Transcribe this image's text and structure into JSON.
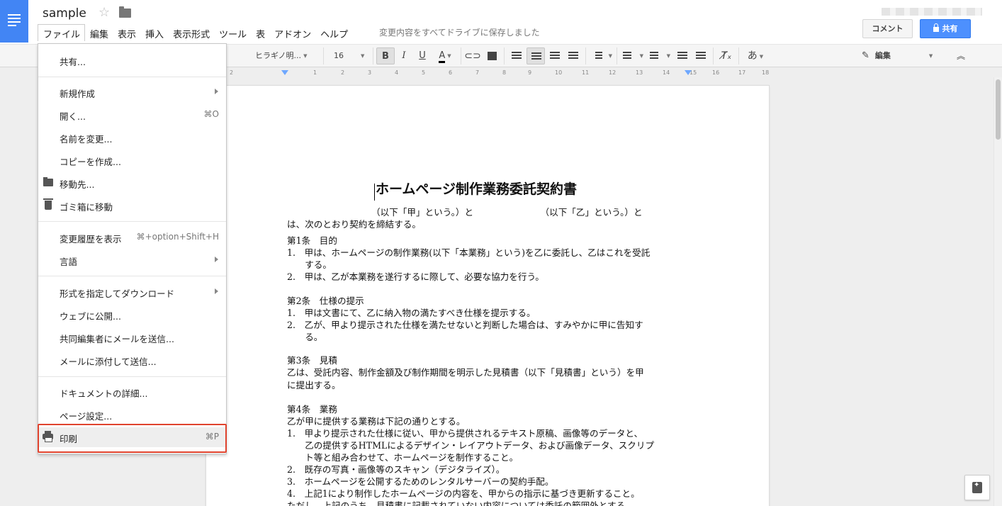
{
  "header": {
    "doc_title": "sample",
    "menu": [
      "ファイル",
      "編集",
      "表示",
      "挿入",
      "表示形式",
      "ツール",
      "表",
      "アドオン",
      "ヘルプ"
    ],
    "save_status": "変更内容をすべてドライブに保存しました",
    "comment_label": "コメント",
    "share_label": "共有"
  },
  "toolbar": {
    "font_name": "ヒラギノ明...",
    "font_size": "16",
    "bold": "B",
    "italic": "I",
    "underline": "U",
    "text_color": "A",
    "input_tools": "あ",
    "mode_label": "編集",
    "text_color_hex": "#000000"
  },
  "ruler": {
    "ticks": [
      "2",
      "1",
      "1",
      "2",
      "3",
      "4",
      "5",
      "6",
      "7",
      "8",
      "9",
      "10",
      "11",
      "12",
      "13",
      "14",
      "15",
      "16",
      "17",
      "18"
    ]
  },
  "file_menu": {
    "items": [
      {
        "label": "共有..."
      },
      {
        "label": "新規作成",
        "submenu": true
      },
      {
        "label": "開く...",
        "shortcut": "⌘O"
      },
      {
        "label": "名前を変更..."
      },
      {
        "label": "コピーを作成..."
      },
      {
        "label": "移動先...",
        "icon": "folder-icon"
      },
      {
        "label": "ゴミ箱に移動",
        "icon": "trash-icon"
      },
      {
        "label": "変更履歴を表示",
        "shortcut": "⌘+option+Shift+H"
      },
      {
        "label": "言語",
        "submenu": true
      },
      {
        "label": "形式を指定してダウンロード",
        "submenu": true
      },
      {
        "label": "ウェブに公開..."
      },
      {
        "label": "共同編集者にメールを送信..."
      },
      {
        "label": "メールに添付して送信..."
      },
      {
        "label": "ドキュメントの詳細..."
      },
      {
        "label": "ページ設定..."
      },
      {
        "label": "印刷",
        "shortcut": "⌘P",
        "icon": "printer-icon",
        "highlighted": true
      }
    ]
  },
  "document": {
    "title": "ホームページ制作業務委託契約書",
    "lines": [
      "（以下「甲」という。）と　　　　　　　　（以下「乙」という。）と",
      "は、次のとおり契約を締結する。",
      "第1条　目的",
      "1.　甲は、ホームページの制作業務(以下「本業務」という)を乙に委託し、乙はこれを受託",
      "　　する。",
      "2.　甲は、乙が本業務を遂行するに際して、必要な協力を行う。",
      "第2条　仕様の提示",
      "1.　甲は文書にて、乙に納入物の満たすべき仕様を提示する。",
      "2.　乙が、甲より提示された仕様を満たせないと判断した場合は、すみやかに甲に告知す",
      "　　る。",
      "第3条　見積",
      "乙は、受託内容、制作金額及び制作期間を明示した見積書（以下「見積書」という）を甲",
      "に提出する。",
      "第4条　業務",
      "乙が甲に提供する業務は下記の通りとする。",
      "1.　甲より提示された仕様に従い、甲から提供されるテキスト原稿、画像等のデータと、",
      "　　乙の提供するHTMLによるデザイン・レイアウトデータ、および画像データ、スクリプ",
      "　　ト等と組み合わせて、ホームページを制作すること。",
      "2.　既存の写真・画像等のスキャン（デジタライズ）。",
      "3.　ホームページを公開するためのレンタルサーバーの契約手配。",
      "4.　上記1により制作したホームページの内容を、甲からの指示に基づき更新すること。",
      "ただし、上記のうち、見積書に記載されていない内容については委託の範囲外とする。"
    ]
  }
}
